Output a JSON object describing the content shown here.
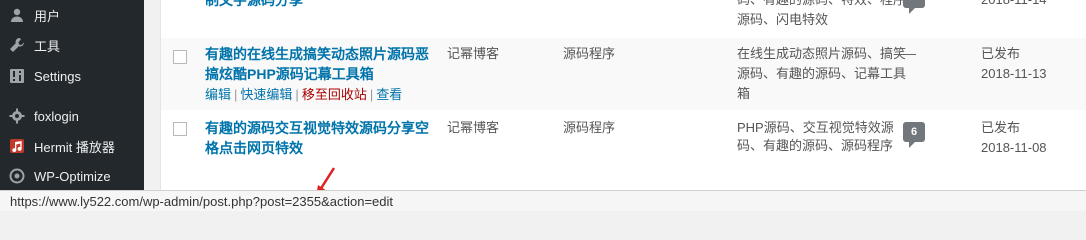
{
  "sidebar": {
    "items": [
      {
        "label": "用户",
        "icon": "user-icon"
      },
      {
        "label": "工具",
        "icon": "wrench-icon"
      },
      {
        "label": "Settings",
        "icon": "settings-icon"
      },
      {
        "label": "foxlogin",
        "icon": "gear-icon"
      },
      {
        "label": "Hermit 播放器",
        "icon": "music-player-icon"
      },
      {
        "label": "WP-Optimize",
        "icon": "optimize-icon"
      }
    ]
  },
  "posts": {
    "top_row": {
      "title_fragment": "制文字源码分享",
      "tags_line1": "码、有趣的源码、特效、程序",
      "tags_line2": "源码、闪电特效",
      "date": "2018-11-14"
    },
    "rows": [
      {
        "title_line1": "有趣的在线生成搞笑动态照片源码恶",
        "title_line2": "搞炫酷PHP源码记幕工具箱",
        "author": "记幂博客",
        "category": "源码程序",
        "tags_line1": "在线生成动态照片源码、搞笑",
        "tags_line2": "源码、有趣的源码、记幕工具",
        "tags_line3": "箱",
        "comments": "—",
        "status": "已发布",
        "date": "2018-11-13",
        "actions": {
          "edit": "编辑",
          "quick_edit": "快速编辑",
          "trash": "移至回收站",
          "view": "查看",
          "separator": "|"
        }
      },
      {
        "title_line1": "有趣的源码交互视觉特效源码分享空",
        "title_line2": "格点击网页特效",
        "author": "记幂博客",
        "category": "源码程序",
        "tags_line1": "PHP源码、交互视觉特效源",
        "tags_line2": "码、有趣的源码、源码程序",
        "comments": "6",
        "status": "已发布",
        "date": "2018-11-08"
      }
    ]
  },
  "statusbar": {
    "url": "https://www.ly522.com/wp-admin/post.php?post=2355&action=edit"
  },
  "colors": {
    "sidebar_bg": "#23282d",
    "link": "#0073aa",
    "trash": "#a00000",
    "annotation_arrow": "#e02020"
  }
}
